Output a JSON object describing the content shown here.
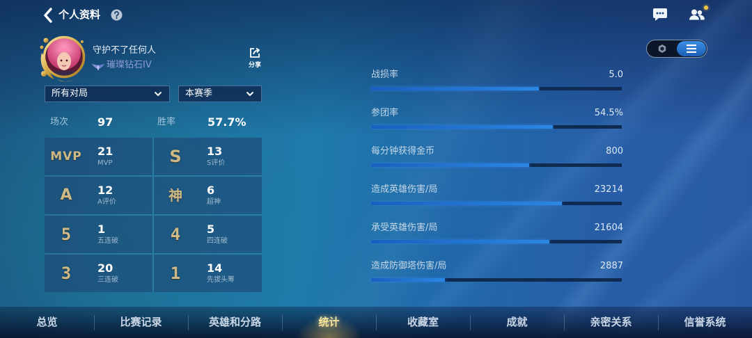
{
  "header": {
    "title": "个人资料",
    "back_icon": "chevron-left-icon",
    "help_icon": "question-circle-icon",
    "chat_icon": "chat-bubble-icon",
    "friends_icon": "friends-icon"
  },
  "profile": {
    "name": "守护不了任何人",
    "rank": "璀璨钻石IV",
    "rank_icon": "rank-wing-icon",
    "share_icon": "share-icon",
    "share_label": "分享"
  },
  "view_toggle": {
    "options": [
      {
        "icon": "hexagon-icon",
        "active": false
      },
      {
        "icon": "list-icon",
        "active": true
      }
    ]
  },
  "filters": {
    "match_type": "所有对局",
    "season": "本赛季"
  },
  "summary": {
    "games_label": "场次",
    "games_value": "97",
    "winrate_label": "胜率",
    "winrate_value": "57.7%"
  },
  "achievements": [
    {
      "badge": "MVP",
      "value": "21",
      "label": "MVP"
    },
    {
      "badge": "S",
      "value": "13",
      "label": "S评价"
    },
    {
      "badge": "A",
      "value": "12",
      "label": "A评价"
    },
    {
      "badge": "神",
      "value": "6",
      "label": "超神"
    },
    {
      "badge": "5",
      "value": "1",
      "label": "五连破"
    },
    {
      "badge": "4",
      "value": "5",
      "label": "四连破"
    },
    {
      "badge": "3",
      "value": "20",
      "label": "三连破"
    },
    {
      "badge": "1",
      "value": "14",
      "label": "先拔头筹"
    }
  ],
  "metrics": [
    {
      "label": "战损率",
      "value": "5.0",
      "fill": 0.67
    },
    {
      "label": "参团率",
      "value": "54.5%",
      "fill": 0.725
    },
    {
      "label": "每分钟获得金币",
      "value": "800",
      "fill": 0.63
    },
    {
      "label": "造成英雄伤害/局",
      "value": "23214",
      "fill": 0.76
    },
    {
      "label": "承受英雄伤害/局",
      "value": "21604",
      "fill": 0.71
    },
    {
      "label": "造成防御塔伤害/局",
      "value": "2887",
      "fill": 0.295
    }
  ],
  "bottom_nav": {
    "tabs": [
      "总览",
      "比赛记录",
      "英雄和分路",
      "统计",
      "收藏室",
      "成就",
      "亲密关系",
      "信誉系统"
    ],
    "active_index": 3
  },
  "colors": {
    "badge_gold": "#cdb985",
    "bar_fill": "#2b88e2",
    "bar_track": "#0f2b52",
    "rank_text": "#8e9cd8",
    "active_tab": "#f4e7a6",
    "notification_dot": "#f2c443"
  }
}
